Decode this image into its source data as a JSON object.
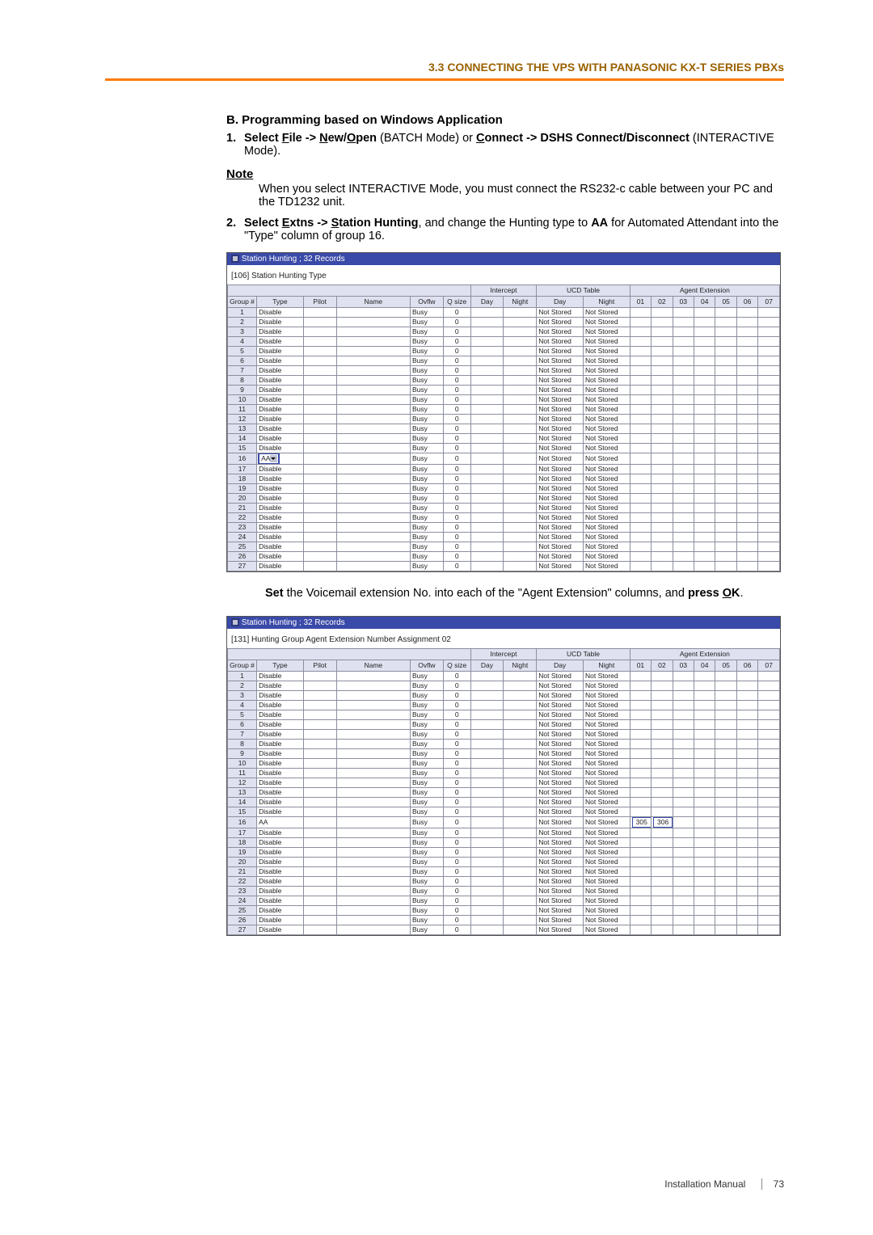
{
  "section_head": "3.3 CONNECTING THE VPS WITH PANASONIC KX-T SERIES PBXs",
  "heading_b": "B. Programming based on Windows Application",
  "step1_num": "1.",
  "step1_pre": "Select ",
  "step1_file": "File",
  "step1_arrow1": " -> ",
  "step1_new": "New/Open",
  "step1_new_underline_N": "N",
  "step1_new_underline_O": "O",
  "step1_batch": " (BATCH Mode) or ",
  "step1_connect": "Connect",
  "step1_arrow2": " -> DSHS Connect/Disconnect",
  "step1_tail": " (INTERACTIVE Mode).",
  "note_head": "Note",
  "note_body": "When you select INTERACTIVE Mode, you must connect the RS232-c cable between your PC and the TD1232 unit.",
  "step2_num": "2.",
  "step2_pre": "Select ",
  "step2_extns": "Extns",
  "step2_arrow": " -> ",
  "step2_station": "Station Hunting",
  "step2_mid": ", and change the Hunting type to ",
  "step2_aa": "AA",
  "step2_tail": " for Automated Attendant into the \"Type\" column of group 16.",
  "win1_title": "Station Hunting ; 32 Records",
  "win1_header": "[106] Station Hunting Type",
  "win2_title": "Station Hunting ; 32 Records",
  "win2_header": "[131] Hunting Group Agent Extension Number Assignment 02",
  "groupcols": {
    "intercept": "Intercept",
    "ucd": "UCD Table",
    "agent": "Agent Extension"
  },
  "cols": {
    "group": "Group #",
    "type": "Type",
    "pilot": "Pilot",
    "name": "Name",
    "ovflw": "Ovflw",
    "qsize": "Q size",
    "day": "Day",
    "night": "Night",
    "ucd_day": "Day",
    "ucd_night": "Night",
    "a01": "01",
    "a02": "02",
    "a03": "03",
    "a04": "04",
    "a05": "05",
    "a06": "06",
    "a07": "07"
  },
  "default_row": {
    "type": "Disable",
    "ovflw": "Busy",
    "qsize": "0",
    "day": "Not Stored",
    "night": "Not Stored"
  },
  "rows1": [
    {
      "g": "1"
    },
    {
      "g": "2"
    },
    {
      "g": "3"
    },
    {
      "g": "4"
    },
    {
      "g": "5"
    },
    {
      "g": "6"
    },
    {
      "g": "7"
    },
    {
      "g": "8"
    },
    {
      "g": "9"
    },
    {
      "g": "10"
    },
    {
      "g": "11"
    },
    {
      "g": "12"
    },
    {
      "g": "13"
    },
    {
      "g": "14"
    },
    {
      "g": "15",
      "type": "Disable"
    },
    {
      "g": "16",
      "type": "AA",
      "dropdown": true
    },
    {
      "g": "17",
      "type": "Disable"
    },
    {
      "g": "18"
    },
    {
      "g": "19"
    },
    {
      "g": "20"
    },
    {
      "g": "21"
    },
    {
      "g": "22"
    },
    {
      "g": "23"
    },
    {
      "g": "24"
    },
    {
      "g": "25"
    },
    {
      "g": "26"
    },
    {
      "g": "27"
    }
  ],
  "rows2": [
    {
      "g": "1"
    },
    {
      "g": "2"
    },
    {
      "g": "3"
    },
    {
      "g": "4"
    },
    {
      "g": "5"
    },
    {
      "g": "6"
    },
    {
      "g": "7"
    },
    {
      "g": "8"
    },
    {
      "g": "9"
    },
    {
      "g": "10"
    },
    {
      "g": "11"
    },
    {
      "g": "12"
    },
    {
      "g": "13"
    },
    {
      "g": "14"
    },
    {
      "g": "15"
    },
    {
      "g": "16",
      "type": "AA",
      "ext01": "305",
      "ext02": "306"
    },
    {
      "g": "17"
    },
    {
      "g": "18"
    },
    {
      "g": "19"
    },
    {
      "g": "20"
    },
    {
      "g": "21"
    },
    {
      "g": "22"
    },
    {
      "g": "23"
    },
    {
      "g": "24"
    },
    {
      "g": "25"
    },
    {
      "g": "26"
    },
    {
      "g": "27"
    }
  ],
  "mid_caption_pre": "Set",
  "mid_caption_mid": " the Voicemail extension No. into each of the \"Agent Extension\" columns, and ",
  "mid_caption_press": "press ",
  "mid_caption_ok": "OK",
  "mid_caption_dot": ".",
  "footer_text": "Installation Manual",
  "footer_page": "73"
}
